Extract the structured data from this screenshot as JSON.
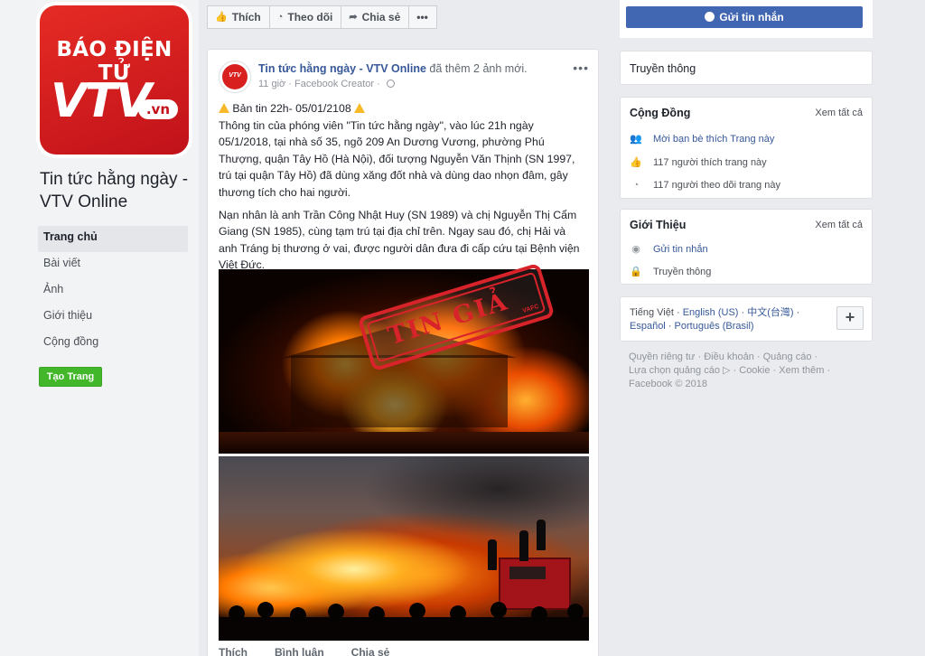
{
  "page": {
    "logo_line1": "BÁO ĐIỆN TỬ",
    "logo_brand": "VTV",
    "logo_domain": ".vn",
    "name": "Tin tức hằng ngày - VTV Online"
  },
  "nav": {
    "items": [
      "Trang chủ",
      "Bài viết",
      "Ảnh",
      "Giới thiệu",
      "Cộng đồng"
    ],
    "create_page": "Tạo Trang"
  },
  "toolbar": {
    "like": "Thích",
    "follow": "Theo dõi",
    "share": "Chia sẻ",
    "more": "•••",
    "send_message": "Gửi tin nhắn"
  },
  "post": {
    "author": "Tin tức hằng ngày - VTV Online",
    "action": "đã thêm 2 ảnh mới.",
    "time": "11 giờ",
    "source": "Facebook Creator",
    "headline": "Bản tin 22h- 05/01/2108",
    "para1": "Thông tin của phóng viên \"Tin tức hằng ngày\", vào lúc 21h ngày 05/1/2018, tại nhà số 35, ngõ 209 An Dương Vương, phường Phú Thượng, quận Tây Hồ (Hà Nội), đối tượng Nguyễn Văn Thịnh (SN 1997, trú tại quận Tây Hồ) đã dùng xăng đốt nhà và dùng dao nhọn đâm, gây thương tích cho hai người.",
    "para2": "Nạn nhân là anh Trần Công Nhật Huy (SN 1989) và chị Nguyễn Thị Cẩm Giang (SN 1985), cùng tạm trú tại địa chỉ trên. Ngay sau đó, chị Hải và anh Tráng bị thương ở vai, được người dân đưa đi cấp cứu tại Bệnh viện Việt Đức.",
    "stamp_text": "TIN GIẢ",
    "stamp_sub": "VAFC",
    "actions": [
      "Thích",
      "Bình luận",
      "Chia sẻ"
    ]
  },
  "sidebar": {
    "media_label": "Truyền thông",
    "community": {
      "title": "Cộng Đồng",
      "see_all": "Xem tất cả",
      "rows": [
        "Mời bạn bè thích Trang này",
        "117 người thích trang này",
        "117 người theo dõi trang này"
      ]
    },
    "about": {
      "title": "Giới Thiệu",
      "see_all": "Xem tất cả",
      "rows": [
        "Gửi tin nhắn",
        "Truyền thông"
      ]
    },
    "languages": {
      "current": "Tiếng Việt",
      "options": [
        "English (US)",
        "中文(台灣)",
        "Español",
        "Português (Brasil)"
      ]
    },
    "footer": {
      "links": [
        "Quyền riêng tư",
        "Điều khoản",
        "Quảng cáo",
        "Lựa chọn quảng cáo",
        "Cookie",
        "Xem thêm"
      ],
      "copyright": "Facebook © 2018"
    }
  },
  "colors": {
    "brand_red": "#d8201e",
    "fb_blue": "#4267b2",
    "link_blue": "#365899",
    "create_green": "#42b72a",
    "stamp_red": "#d8232a"
  },
  "icons": [
    "thumbs-up-icon",
    "rss-icon",
    "share-arrow-icon",
    "messenger-icon",
    "globe-icon",
    "warning-icon",
    "users-icon",
    "lock-icon",
    "plus-icon"
  ]
}
